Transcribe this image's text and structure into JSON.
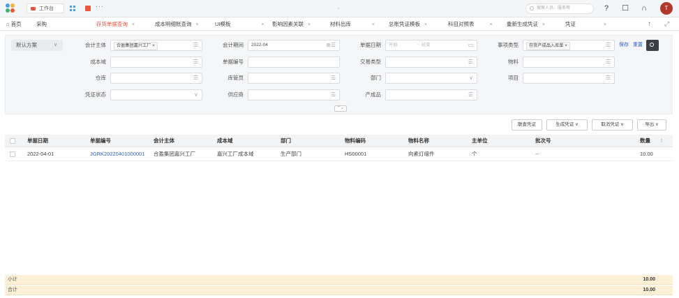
{
  "topbar": {
    "workbench": "工作台",
    "more": "···",
    "search_placeholder": "搜索人员、服务等",
    "avatar": "T"
  },
  "tabs": [
    {
      "label": "首页",
      "x": "",
      "active": false
    },
    {
      "label": "采购",
      "x": "",
      "active": false
    },
    {
      "label": "存货单据查询",
      "x": "×",
      "active": true
    },
    {
      "label": "成本明细账查询",
      "x": "×",
      "active": false
    },
    {
      "label": "UI模板",
      "x": "×",
      "active": false
    },
    {
      "label": "影响因素关联",
      "x": "×",
      "active": false
    },
    {
      "label": "材料出库",
      "x": "×",
      "active": false
    },
    {
      "label": "总账凭证模板",
      "x": "×",
      "active": false
    },
    {
      "label": "科目对照表",
      "x": "×",
      "active": false
    },
    {
      "label": "重新生成凭证",
      "x": "×",
      "active": false
    },
    {
      "label": "凭证",
      "x": "×",
      "active": false
    }
  ],
  "filter": {
    "plan": "默认方案",
    "labels": {
      "entity": "会计主体",
      "period": "会计期间",
      "bill_date": "单据日期",
      "type": "事项类型",
      "cost_domain": "成本域",
      "bill_no": "单据编号",
      "tx_type": "交易类型",
      "material": "物料",
      "warehouse": "仓库",
      "keeper": "库管员",
      "dept": "部门",
      "project": "项目",
      "voucher_status": "凭证状态",
      "supplier": "供应商",
      "product": "产成品"
    },
    "entity_tag": "合盈集团嘉兴工厂 ×",
    "period_value": "2022-04",
    "date_start": "开始",
    "date_end": "~ 结束",
    "type_tag": "存货产成品入库单 ×",
    "save_label": "保存",
    "reset_label": "重置"
  },
  "actions": {
    "link": "联查凭证",
    "generate": "生成凭证",
    "cancel": "取消凭证",
    "export": "导出"
  },
  "table": {
    "headers": [
      "单据日期",
      "单据编号",
      "会计主体",
      "成本域",
      "部门",
      "物料编码",
      "物料名称",
      "主单位",
      "批次号",
      "数量"
    ],
    "rows": [
      [
        "2022-04-01",
        "JGRK20220401000001",
        "合盈集团嘉兴工厂",
        "嘉兴工厂成本域",
        "生产部门",
        "HS00001",
        "向素灯组件",
        "个",
        "--",
        "10.00"
      ]
    ]
  },
  "summary": {
    "subtotal_label": "小计",
    "subtotal": "10.00",
    "total_label": "合计",
    "total": "10.00"
  }
}
